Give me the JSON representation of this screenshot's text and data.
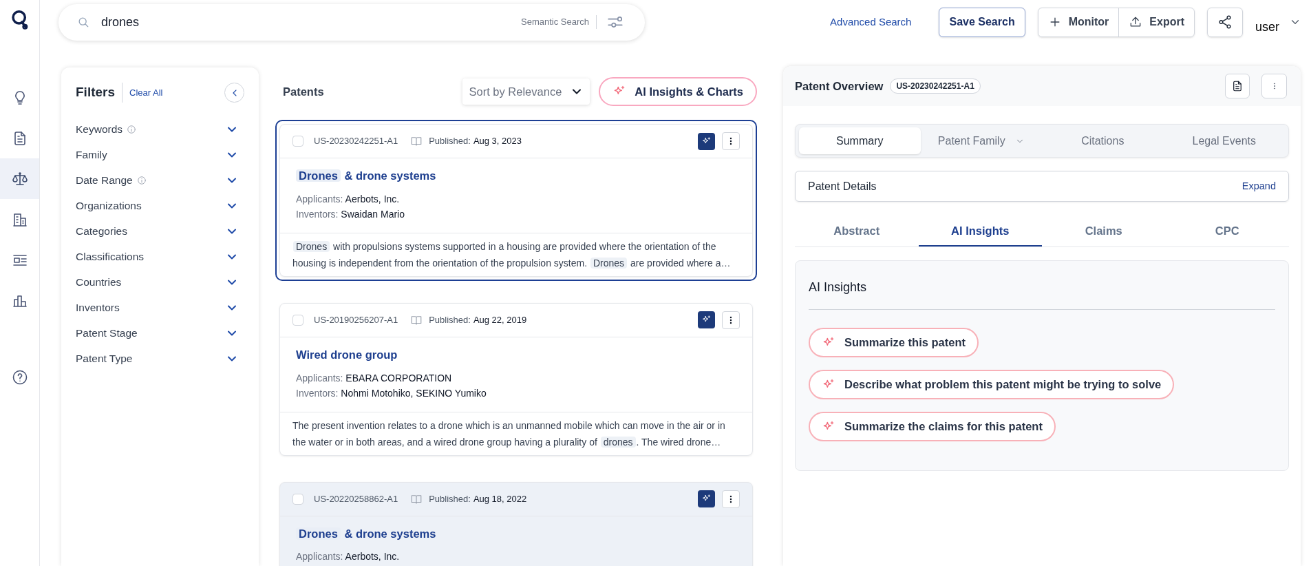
{
  "rail": {
    "items": [
      {
        "kind": "bulb",
        "selected": false
      },
      {
        "kind": "document",
        "selected": false
      },
      {
        "kind": "scales",
        "selected": true
      },
      {
        "kind": "building",
        "selected": false
      },
      {
        "kind": "list",
        "selected": false
      },
      {
        "kind": "chart",
        "selected": false
      }
    ],
    "help": true
  },
  "search": {
    "value": "drones",
    "mode": "Semantic Search"
  },
  "top_actions": {
    "advanced": "Advanced Search",
    "save": "Save Search",
    "monitor": "Monitor",
    "export": "Export",
    "user": "user"
  },
  "filters": {
    "title": "Filters",
    "clear": "Clear All",
    "items": [
      {
        "label": "Keywords",
        "info": true
      },
      {
        "label": "Family",
        "info": false
      },
      {
        "label": "Date Range",
        "info": true
      },
      {
        "label": "Organizations",
        "info": false
      },
      {
        "label": "Categories",
        "info": false
      },
      {
        "label": "Classifications",
        "info": false
      },
      {
        "label": "Countries",
        "info": false
      },
      {
        "label": "Inventors",
        "info": false
      },
      {
        "label": "Patent Stage",
        "info": false
      },
      {
        "label": "Patent Type",
        "info": false
      }
    ]
  },
  "patents": {
    "title": "Patents",
    "sort": "Sort by Relevance",
    "ai_button": "AI Insights & Charts",
    "cards": [
      {
        "selected": true,
        "hovered": false,
        "number": "US-20230242251-A1",
        "published_label": "Published:",
        "date": "Aug 3, 2023",
        "title": [
          {
            "text": "Drones",
            "highlight": true
          },
          {
            "text": " & drone systems",
            "highlight": false
          }
        ],
        "applicants_label": "Applicants:",
        "applicants": "Aerbots, Inc.",
        "inventors_label": "Inventors:",
        "inventors": "Swaidan Mario",
        "abstract": [
          {
            "text": "Drones",
            "highlight": true
          },
          {
            "text": " with propulsions systems supported in a housing are provided where the orientation of the housing is independent from the orientation of the propulsion system. ",
            "highlight": false
          },
          {
            "text": "Drones",
            "highlight": true
          },
          {
            "text": " are provided where a…",
            "highlight": false
          }
        ]
      },
      {
        "selected": false,
        "hovered": false,
        "number": "US-20190256207-A1",
        "published_label": "Published:",
        "date": "Aug 22, 2019",
        "title": [
          {
            "text": "Wired drone group",
            "highlight": false
          }
        ],
        "applicants_label": "Applicants:",
        "applicants": "EBARA CORPORATION",
        "inventors_label": "Inventors:",
        "inventors": "Nohmi Motohiko, SEKINO Yumiko",
        "abstract": [
          {
            "text": "The present invention relates to a drone which is an unmanned mobile which can move in the air or in the water or in both areas, and a wired drone group having a plurality of ",
            "highlight": false
          },
          {
            "text": "drones",
            "highlight": true
          },
          {
            "text": ". The wired drone…",
            "highlight": false
          }
        ]
      },
      {
        "selected": false,
        "hovered": true,
        "number": "US-20220258862-A1",
        "published_label": "Published:",
        "date": "Aug 18, 2022",
        "title": [
          {
            "text": "Drones",
            "highlight": true
          },
          {
            "text": " & drone systems",
            "highlight": false
          }
        ],
        "applicants_label": "Applicants:",
        "applicants": "Aerbots, Inc."
      }
    ]
  },
  "overview": {
    "title": "Patent Overview",
    "number": "US-20230242251-A1",
    "tabs": [
      {
        "label": "Summary",
        "selected": true,
        "dropdown": false
      },
      {
        "label": "Patent Family",
        "selected": false,
        "dropdown": true
      },
      {
        "label": "Citations",
        "selected": false,
        "dropdown": false
      },
      {
        "label": "Legal Events",
        "selected": false,
        "dropdown": false
      }
    ],
    "details": {
      "label": "Patent Details",
      "action": "Expand"
    },
    "subtabs": [
      {
        "label": "Abstract",
        "selected": false
      },
      {
        "label": "AI Insights",
        "selected": true
      },
      {
        "label": "Claims",
        "selected": false
      },
      {
        "label": "CPC",
        "selected": false
      }
    ],
    "insights": {
      "title": "AI Insights",
      "prompts": [
        "Summarize this patent",
        "Describe what problem this patent might be trying to solve",
        "Summarize the claims for this patent"
      ]
    }
  }
}
